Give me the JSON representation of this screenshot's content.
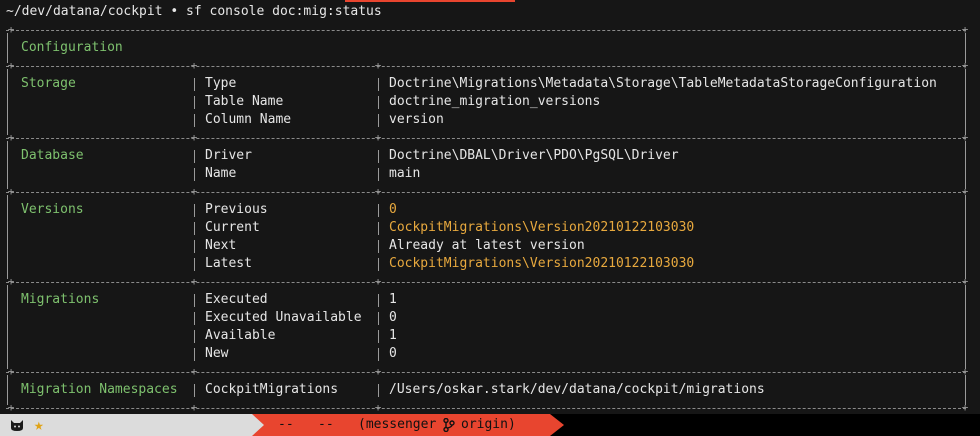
{
  "prompt": {
    "path": "~/dev/datana/cockpit",
    "bullet": "•",
    "command": "sf console doc:mig:status"
  },
  "sections": [
    {
      "title": "Configuration",
      "rows": []
    },
    {
      "title": "Storage",
      "rows": [
        {
          "key": "Type",
          "value": "Doctrine\\Migrations\\Metadata\\Storage\\TableMetadataStorageConfiguration",
          "highlight": false
        },
        {
          "key": "Table Name",
          "value": "doctrine_migration_versions",
          "highlight": false
        },
        {
          "key": "Column Name",
          "value": "version",
          "highlight": false
        }
      ]
    },
    {
      "title": "Database",
      "rows": [
        {
          "key": "Driver",
          "value": "Doctrine\\DBAL\\Driver\\PDO\\PgSQL\\Driver",
          "highlight": false
        },
        {
          "key": "Name",
          "value": "main",
          "highlight": false
        }
      ]
    },
    {
      "title": "Versions",
      "rows": [
        {
          "key": "Previous",
          "value": "0",
          "highlight": true
        },
        {
          "key": "Current",
          "value": "CockpitMigrations\\Version20210122103030",
          "highlight": true
        },
        {
          "key": "Next",
          "value": "Already at latest version",
          "highlight": false
        },
        {
          "key": "Latest",
          "value": "CockpitMigrations\\Version20210122103030",
          "highlight": true
        }
      ]
    },
    {
      "title": "Migrations",
      "rows": [
        {
          "key": "Executed",
          "value": "1",
          "highlight": false
        },
        {
          "key": "Executed Unavailable",
          "value": "0",
          "highlight": false
        },
        {
          "key": "Available",
          "value": "1",
          "highlight": false
        },
        {
          "key": "New",
          "value": "0",
          "highlight": false
        }
      ]
    },
    {
      "title": "Migration Namespaces",
      "rows": [
        {
          "key": "CockpitMigrations",
          "value": "/Users/oskar.stark/dev/datana/cockpit/migrations",
          "highlight": false
        }
      ]
    }
  ],
  "statusbar": {
    "left_icons": [
      "cat-icon",
      "star-icon"
    ],
    "dashes_1": "--",
    "dashes_2": "--",
    "session": "(messenger",
    "branch_icon": "git-branch-icon",
    "branch": "origin)"
  },
  "colors": {
    "background": "#161616",
    "section_title": "#7ec16e",
    "highlight_value": "#e8a93e",
    "status_red": "#e8452f",
    "status_gray": "#dcdcdc"
  }
}
